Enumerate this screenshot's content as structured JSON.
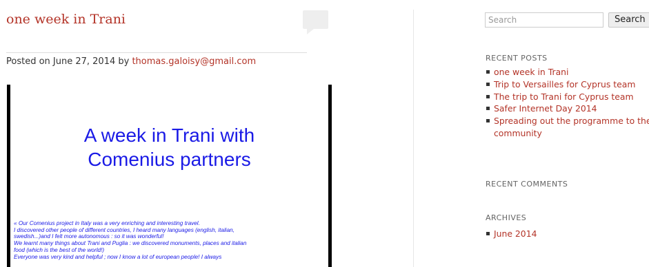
{
  "post": {
    "title": "one week in Trani",
    "meta_prefix": "Posted on June 27, 2014 by ",
    "author": "thomas.galoisy@gmail.com",
    "image": {
      "title_line1": "A week in Trani with",
      "title_line2": "Comenius partners",
      "body_lines": [
        "« Our Comenius project in Italy was a very enriching and interesting travel.",
        "I discovered other people of different countries, I heard many languages (english, italian,",
        "swedish...)and I felt more autonomous : so it was wonderful!",
        "We learnt many things about Trani and Puglia : we discovered monuments, places and italian",
        "food (which is the best of the world!)",
        "Everyone was very kind and helpful ; now I know a lot of european people! I always"
      ]
    }
  },
  "sidebar": {
    "search": {
      "placeholder": "Search",
      "button": "Search"
    },
    "recent_posts": {
      "title": "RECENT POSTS",
      "items": [
        "one week in Trani",
        "Trip to Versailles for Cyprus team",
        "The trip to Trani for Cyprus team",
        "Safer Internet Day 2014",
        "Spreading out the programme to the community"
      ]
    },
    "recent_comments": {
      "title": "RECENT COMMENTS"
    },
    "archives": {
      "title": "ARCHIVES",
      "items": [
        "June 2014"
      ]
    }
  },
  "colors": {
    "link": "#b33327",
    "slide_text": "#1a1ae6",
    "text": "#333333"
  }
}
